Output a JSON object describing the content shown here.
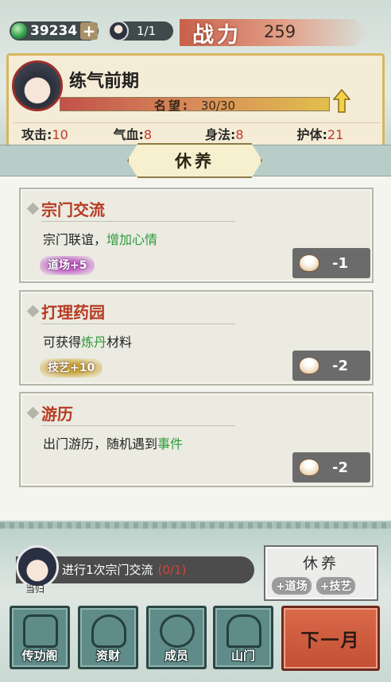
{
  "top_bar": {
    "jade_count": "39234",
    "jade_add_icon": "plus-icon",
    "disciples": "1/1",
    "power_label": "战力",
    "power_value": "259"
  },
  "profile": {
    "realm": "练气前期",
    "reputation_label": "名望:",
    "reputation_value": "30/30",
    "reputation_fraction": 1.0,
    "upgrade_icon": "arrow-up-icon",
    "stats": [
      {
        "label": "攻击:",
        "value": "10"
      },
      {
        "label": "气血:",
        "value": "8"
      },
      {
        "label": "身法:",
        "value": "8"
      },
      {
        "label": "护体:",
        "value": "21"
      }
    ]
  },
  "section_title": "休养",
  "activities": [
    {
      "title": "宗门交流",
      "desc_prefix": "宗门联谊，",
      "desc_highlight": "增加心情",
      "desc_suffix": "",
      "tag": "道场+5",
      "cost": "-1"
    },
    {
      "title": "打理药园",
      "desc_prefix": "可获得",
      "desc_highlight": "炼丹",
      "desc_suffix": "材料",
      "tag": "技艺+10",
      "cost": "-2"
    },
    {
      "title": "游历",
      "desc_prefix": "出门游历，随机遇到",
      "desc_highlight": "事件",
      "desc_suffix": "",
      "tag": "",
      "cost": "-2"
    }
  ],
  "task": {
    "character_name": "当归",
    "text": "进行1次宗门交流",
    "progress": "(0/1)"
  },
  "rest_panel": {
    "title": "休养",
    "chip_1": "+道场",
    "chip_2": "+技艺"
  },
  "nav": {
    "btn_1": "传功阁",
    "btn_2": "资财",
    "btn_3": "成员",
    "btn_4": "山门",
    "next": "下一月"
  },
  "colors": {
    "accent_red": "#c0392b",
    "highlight_green": "#2e9a3a",
    "next_button": "#c34f34"
  }
}
